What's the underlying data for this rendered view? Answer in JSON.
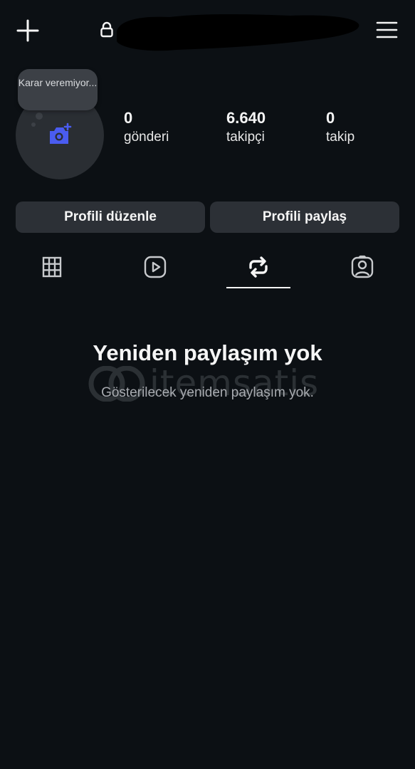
{
  "header": {
    "add_icon": "plus-icon",
    "lock_icon": "lock-icon",
    "menu_icon": "hamburger-menu-icon"
  },
  "profile": {
    "note_text": "Karar veremiyor...",
    "avatar_icon": "add-photo-camera-icon",
    "stats": {
      "posts_count": "0",
      "posts_label": "gönderi",
      "followers_count": "6.640",
      "followers_label": "takipçi",
      "following_count": "0",
      "following_label": "takip"
    }
  },
  "actions": {
    "edit_profile": "Profili düzenle",
    "share_profile": "Profili paylaş"
  },
  "tabs": [
    {
      "icon": "grid-icon",
      "active": false
    },
    {
      "icon": "reels-play-icon",
      "active": false
    },
    {
      "icon": "repost-icon",
      "active": true
    },
    {
      "icon": "tagged-person-icon",
      "active": false
    }
  ],
  "empty_state": {
    "title": "Yeniden paylaşım yok",
    "subtitle": "Gösterilecek yeniden paylaşım yok."
  },
  "watermark": {
    "text": "itemsatis"
  },
  "colors": {
    "background": "#0c1014",
    "button": "#2c3036",
    "accent_camera": "#4a5cf0",
    "text": "#f5f5f5",
    "muted_text": "#a8abb0"
  }
}
